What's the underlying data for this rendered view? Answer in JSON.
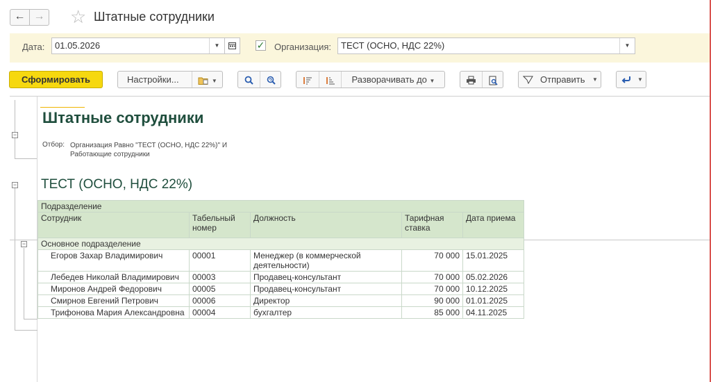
{
  "window": {
    "title": "Штатные сотрудники",
    "back_icon": "←",
    "forward_icon": "→",
    "favorite_icon": "☆"
  },
  "params": {
    "date_label": "Дата:",
    "date_value": "01.05.2026",
    "org_label": "Организация:",
    "org_value": "ТЕСТ (ОСНО, НДС 22%)",
    "org_checked": true
  },
  "toolbar": {
    "generate_label": "Сформировать",
    "settings_label": "Настройки...",
    "expand_label": "Разворачивать до",
    "send_label": "Отправить"
  },
  "report": {
    "title": "Штатные сотрудники",
    "filter_label": "Отбор:",
    "filter_value": "Организация Равно \"ТЕСТ (ОСНО, НДС 22%)\" И Работающие сотрудники",
    "org_title": "ТЕСТ (ОСНО, НДС 22%)",
    "header_group": "Подразделение",
    "columns": {
      "employee": "Сотрудник",
      "tab_no": "Табельный номер",
      "position": "Должность",
      "rate": "Тарифная ставка",
      "hire_date": "Дата приема"
    },
    "group_name": "Основное подразделение",
    "rows": [
      {
        "employee": "Егоров Захар Владимирович",
        "tab_no": "00001",
        "position": "Менеджер (в коммерческой деятельности)",
        "rate": "70 000",
        "hire_date": "15.01.2025"
      },
      {
        "employee": "Лебедев Николай Владимирович",
        "tab_no": "00003",
        "position": "Продавец-консультант",
        "rate": "70 000",
        "hire_date": "05.02.2026"
      },
      {
        "employee": "Миронов Андрей Федорович",
        "tab_no": "00005",
        "position": "Продавец-консультант",
        "rate": "70 000",
        "hire_date": "10.12.2025"
      },
      {
        "employee": "Смирнов Евгений Петрович",
        "tab_no": "00006",
        "position": "Директор",
        "rate": "90 000",
        "hire_date": "01.01.2025"
      },
      {
        "employee": "Трифонова Мария Александровна",
        "tab_no": "00004",
        "position": "бухгалтер",
        "rate": "85 000",
        "hire_date": "04.11.2025"
      }
    ]
  },
  "colors": {
    "primary_button": "#f6d80f",
    "param_bar": "#fbf6dc",
    "header_green": "#d5e6cc",
    "title_green": "#1f4e3d"
  }
}
